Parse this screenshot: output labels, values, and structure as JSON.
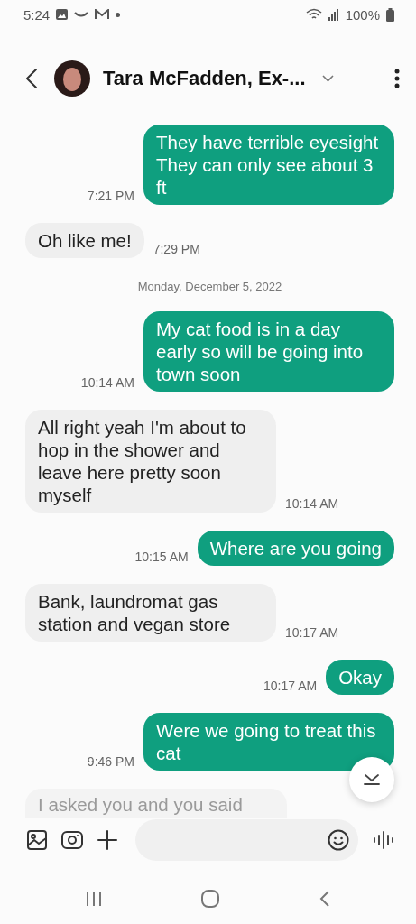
{
  "status_bar": {
    "time": "5:24",
    "battery": "100%"
  },
  "header": {
    "contact": "Tara McFadden, Ex-..."
  },
  "messages": [
    {
      "kind": "sent",
      "text": "They have terrible eyesight They can only see about 3 ft",
      "time": "7:21 PM"
    },
    {
      "kind": "received",
      "text": "Oh like me!",
      "time": "7:29 PM"
    },
    {
      "kind": "date",
      "text": "Monday, December 5, 2022"
    },
    {
      "kind": "sent",
      "text": "My cat food is in a day early so will be going into town soon",
      "time": "10:14 AM"
    },
    {
      "kind": "received",
      "text": "All right yeah I'm about to hop in the shower and leave here pretty soon myself",
      "time": "10:14 AM"
    },
    {
      "kind": "sent",
      "text": "Where are you going",
      "time": "10:15 AM"
    },
    {
      "kind": "received",
      "text": "Bank, laundromat gas station and vegan store",
      "time": "10:17 AM"
    },
    {
      "kind": "sent",
      "text": "Okay",
      "time": "10:17 AM"
    },
    {
      "kind": "sent",
      "text": "Were we going to treat this cat",
      "time": "9:46 PM"
    },
    {
      "kind": "faded",
      "text": "I asked you and you said"
    }
  ]
}
